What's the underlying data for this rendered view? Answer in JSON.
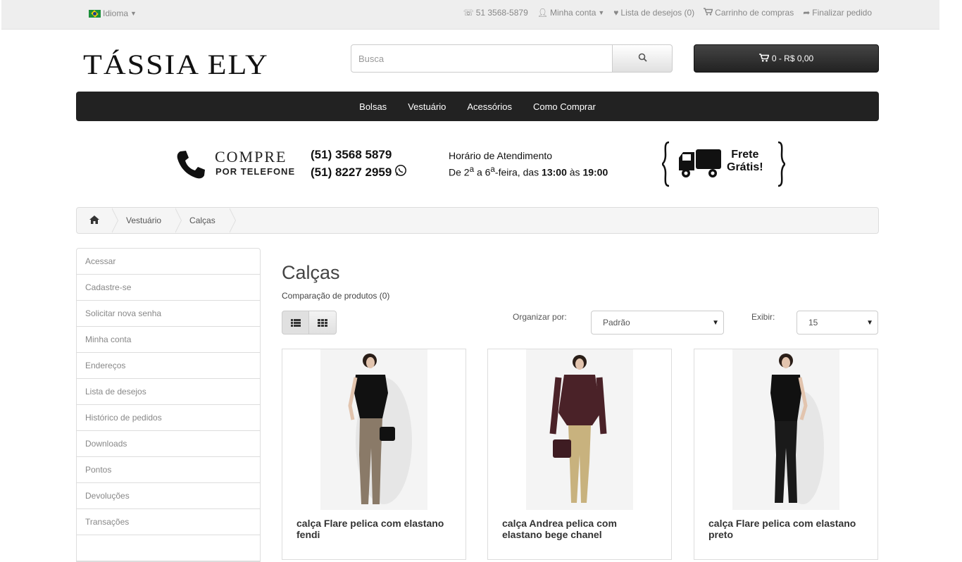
{
  "topbar": {
    "language_label": "Idioma",
    "phone": "51 3568-5879",
    "account": "Minha conta",
    "wishlist": "Lista de desejos (0)",
    "cart": "Carrinho de compras",
    "checkout": "Finalizar pedido"
  },
  "header": {
    "logo": "TÁSSIA ELY",
    "search_placeholder": "Busca",
    "cart_button": "0 - R$ 0,00"
  },
  "menu": [
    "Bolsas",
    "Vestuário",
    "Acessórios",
    "Como Comprar"
  ],
  "banner": {
    "compre_line1": "COMPRE",
    "compre_line2": "POR TELEFONE",
    "phone1": "(51) 3568 5879",
    "phone2": "(51) 8227 2959",
    "hours_title": "Horário de Atendimento",
    "hours_prefix": "De 2",
    "hours_sup1": "a",
    "hours_mid": " a 6",
    "hours_sup2": "a",
    "hours_mid2": "-feira, das ",
    "hours_from": "13:00",
    "hours_sep": " às ",
    "hours_to": "19:00",
    "frete_line1": "Frete",
    "frete_line2": "Grátis!"
  },
  "breadcrumb": [
    "Vestuário",
    "Calças"
  ],
  "sidebar": [
    "Acessar",
    "Cadastre-se",
    "Solicitar nova senha",
    "Minha conta",
    "Endereços",
    "Lista de desejos",
    "Histórico de pedidos",
    "Downloads",
    "Pontos",
    "Devoluções",
    "Transações"
  ],
  "content": {
    "title": "Calças",
    "compare": "Comparação de produtos (0)",
    "sort_label": "Organizar por:",
    "sort_value": "Padrão",
    "show_label": "Exibir:",
    "show_value": "15"
  },
  "products": [
    {
      "name": "calça Flare pelica com elastano fendi",
      "pants_color": "#8a7a68",
      "top_color": "#111111"
    },
    {
      "name": "calça Andrea pelica com elastano bege chanel",
      "pants_color": "#c8b27e",
      "top_color": "#4a2228"
    },
    {
      "name": "calça Flare pelica com elastano preto",
      "pants_color": "#1a1a1a",
      "top_color": "#111111"
    }
  ],
  "colors": {
    "menu_bg": "#222222",
    "topbar_bg": "#eeeeee",
    "cart_bg": "#2b2b2b"
  }
}
